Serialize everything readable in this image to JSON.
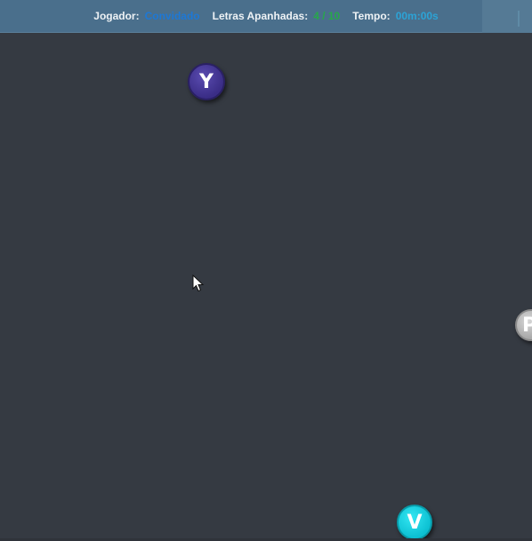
{
  "hud": {
    "player_label": "Jogador:",
    "player_value": "Convidado",
    "letters_label": "Letras Apanhadas:",
    "letters_value": "4 / 10",
    "time_label": "Tempo:",
    "time_value": "00m:00s"
  },
  "balls": [
    {
      "letter": "Y",
      "color": "#3a2d86"
    },
    {
      "letter": "V",
      "color": "#0cc0d2"
    },
    {
      "letter": "P",
      "color": "#a8a8a8"
    }
  ],
  "colors": {
    "background": "#353a42",
    "hud": "#4a6f8c",
    "player": "#1d78d6",
    "letters": "#27a84a",
    "time": "#2ca3d6"
  },
  "icons": {
    "cursor": "mouse-pointer-icon"
  }
}
